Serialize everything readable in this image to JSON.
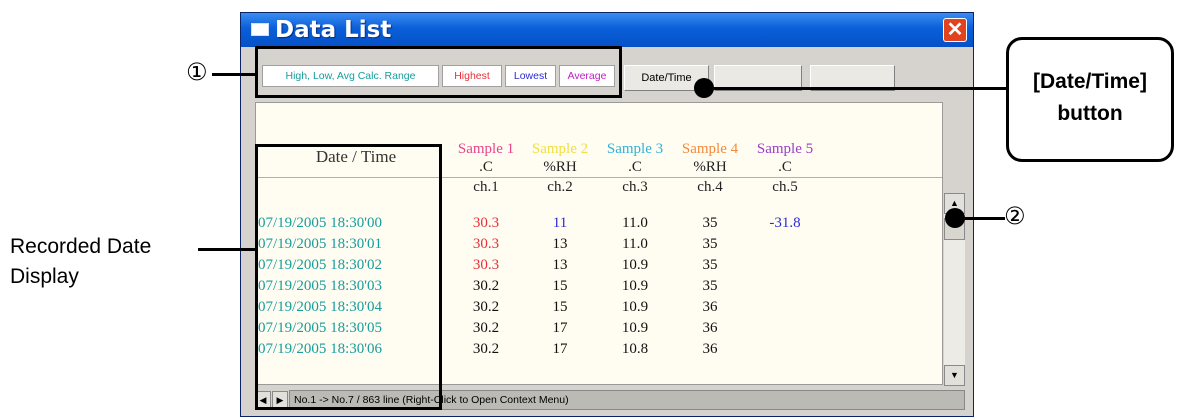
{
  "window": {
    "title": "Data List",
    "close_glyph": "✕"
  },
  "toolbar": {
    "calc_label": "High, Low, Avg Calc. Range",
    "highest_label": "Highest",
    "lowest_label": "Lowest",
    "average_label": "Average",
    "datetime_button_label": "Date/Time",
    "hidden_button_2_label": "",
    "hidden_button_3_label": ""
  },
  "grid": {
    "date_header": "Date / Time",
    "columns": [
      {
        "name": "Sample 1",
        "unit": ".C",
        "channel": "ch.1",
        "color": "#e8468a"
      },
      {
        "name": "Sample 2",
        "unit": "%RH",
        "channel": "ch.2",
        "color": "#f0e040"
      },
      {
        "name": "Sample 3",
        "unit": ".C",
        "channel": "ch.3",
        "color": "#2fb2d9"
      },
      {
        "name": "Sample 4",
        "unit": "%RH",
        "channel": "ch.4",
        "color": "#f58a3c"
      },
      {
        "name": "Sample 5",
        "unit": ".C",
        "channel": "ch.5",
        "color": "#9a3ec8"
      }
    ],
    "rows": [
      {
        "date": "07/19/2005  18:30'00",
        "values": [
          "30.3",
          "11",
          "11.0",
          "35",
          "-31.8"
        ]
      },
      {
        "date": "07/19/2005  18:30'01",
        "values": [
          "30.3",
          "13",
          "11.0",
          "35",
          ""
        ]
      },
      {
        "date": "07/19/2005  18:30'02",
        "values": [
          "30.3",
          "13",
          "10.9",
          "35",
          ""
        ]
      },
      {
        "date": "07/19/2005  18:30'03",
        "values": [
          "30.2",
          "15",
          "10.9",
          "35",
          ""
        ]
      },
      {
        "date": "07/19/2005  18:30'04",
        "values": [
          "30.2",
          "15",
          "10.9",
          "36",
          ""
        ]
      },
      {
        "date": "07/19/2005  18:30'05",
        "values": [
          "30.2",
          "17",
          "10.9",
          "36",
          ""
        ]
      },
      {
        "date": "07/19/2005  18:30'06",
        "values": [
          "30.2",
          "17",
          "10.8",
          "36",
          ""
        ]
      }
    ]
  },
  "statusbar": {
    "text": "No.1 -> No.7 / 863 line   (Right-Click to Open Context Menu)"
  },
  "scroll": {
    "up_glyph": "▲",
    "down_glyph": "▼",
    "left_glyph": "◀",
    "right_glyph": "▶"
  },
  "annotations": {
    "marker_1": "①",
    "marker_2": "②",
    "callout_line1": "[Date/Time]",
    "callout_line2": "button",
    "side_label_line1": "Recorded Date",
    "side_label_line2": "Display"
  },
  "colors": {
    "titlebar": "#0a5fd8",
    "date_text": "#169d9d",
    "highest": "#e8303a",
    "lowest": "#2b2bd6",
    "average": "#c020c0"
  }
}
